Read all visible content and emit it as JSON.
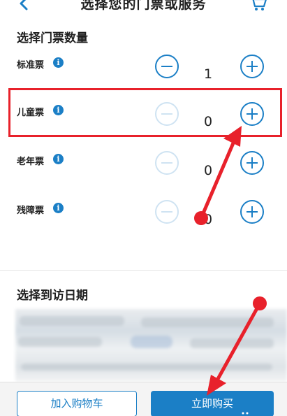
{
  "header": {
    "title": "选择您的门票或服务",
    "back_icon": "chevron-left-icon",
    "cart_icon": "cart-icon"
  },
  "quantity_section": {
    "title": "选择门票数量",
    "tickets": [
      {
        "label": "标准票",
        "quantity": "1",
        "minus_enabled": true
      },
      {
        "label": "儿童票",
        "quantity": "0",
        "minus_enabled": false
      },
      {
        "label": "老年票",
        "quantity": "0",
        "minus_enabled": false
      },
      {
        "label": "残障票",
        "quantity": "0",
        "minus_enabled": false
      }
    ]
  },
  "date_section": {
    "title": "选择到访日期"
  },
  "footer": {
    "add_to_cart_label": "加入购物车",
    "buy_now_label": "立即购买"
  },
  "colors": {
    "accent": "#1b7fc6",
    "accent_disabled": "#cfe3f2",
    "annotation": "#e8212b"
  }
}
